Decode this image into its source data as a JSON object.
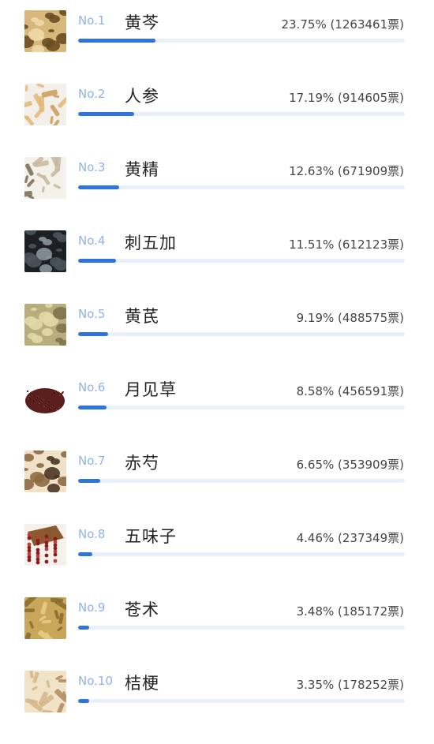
{
  "ranking": {
    "items": [
      {
        "rank": "No.1",
        "name": "黄芩",
        "stat": "23.75% (1263461票)",
        "percent": 23.75,
        "thumb": "herb-slices-icon",
        "colors": [
          "#d7b77a",
          "#6a4d22",
          "#f0d9a8"
        ]
      },
      {
        "rank": "No.2",
        "name": "人参",
        "stat": "17.19% (914605票)",
        "percent": 17.19,
        "thumb": "ginseng-root-icon",
        "colors": [
          "#f3efe9",
          "#e2b777",
          "#c99b58"
        ]
      },
      {
        "rank": "No.3",
        "name": "黄精",
        "stat": "12.63% (671909票)",
        "percent": 12.63,
        "thumb": "rhizome-icon",
        "colors": [
          "#f4f1ea",
          "#c7b99f",
          "#7a6a52"
        ]
      },
      {
        "rank": "No.4",
        "name": "刺五加",
        "stat": "11.51% (612123票)",
        "percent": 11.51,
        "thumb": "black-berries-icon",
        "colors": [
          "#1c1f23",
          "#4a535b",
          "#8a939a"
        ]
      },
      {
        "rank": "No.5",
        "name": "黄芪",
        "stat": "9.19% (488575票)",
        "percent": 9.19,
        "thumb": "root-slices-icon",
        "colors": [
          "#b8ad7d",
          "#e3d9a9",
          "#7f744a"
        ]
      },
      {
        "rank": "No.6",
        "name": "月见草",
        "stat": "8.58% (456591票)",
        "percent": 8.58,
        "thumb": "seed-pile-icon",
        "colors": [
          "#5a1f1c",
          "#7b3a32",
          "#ffffff"
        ]
      },
      {
        "rank": "No.7",
        "name": "赤芍",
        "stat": "6.65% (353909票)",
        "percent": 6.65,
        "thumb": "dried-slices-icon",
        "colors": [
          "#efe2c9",
          "#8e6a43",
          "#4a3622"
        ]
      },
      {
        "rank": "No.8",
        "name": "五味子",
        "stat": "4.46% (237349票)",
        "percent": 4.46,
        "thumb": "red-berries-icon",
        "colors": [
          "#8a1c1c",
          "#c23b3b",
          "#f4f1ec"
        ]
      },
      {
        "rank": "No.9",
        "name": "苍术",
        "stat": "3.48% (185172票)",
        "percent": 3.48,
        "thumb": "rhizome-chunks-icon",
        "colors": [
          "#c9a75a",
          "#8a6a2e",
          "#e8cd8a"
        ]
      },
      {
        "rank": "No.10",
        "name": "桔梗",
        "stat": "3.35% (178252票)",
        "percent": 3.35,
        "thumb": "root-shreds-icon",
        "colors": [
          "#f1e3c8",
          "#d4b68a",
          "#b08a5c"
        ]
      }
    ]
  },
  "colors": {
    "accent": "#2f73dc",
    "track": "#eaf0fa",
    "rank_text": "#8fb2e8"
  }
}
